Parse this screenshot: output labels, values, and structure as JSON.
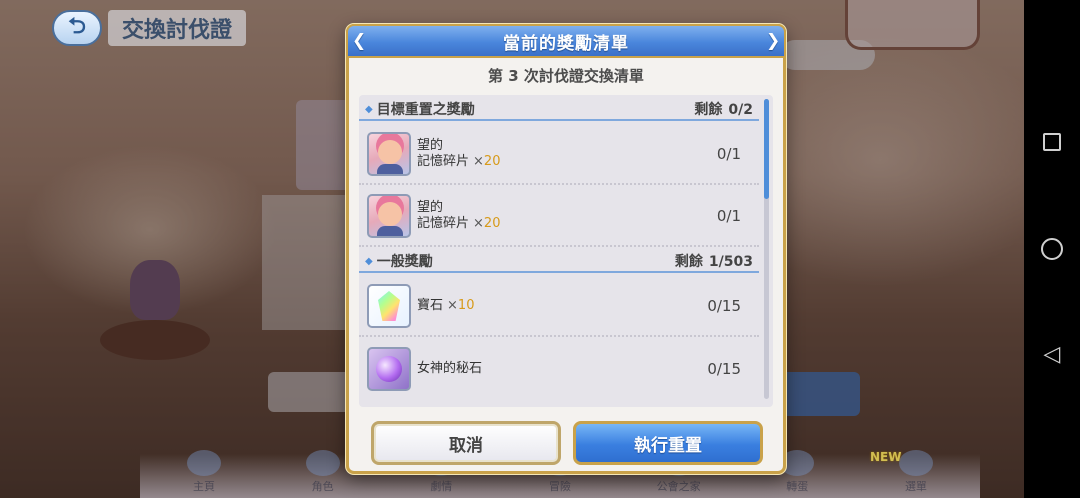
{
  "background": {
    "page_title": "交換討伐證",
    "back_icon": "back-arrow-icon",
    "nav_items": [
      "主頁",
      "角色",
      "劇情",
      "冒險",
      "公會之家",
      "轉蛋",
      "選單"
    ],
    "new_badge": "NEW"
  },
  "dialog": {
    "title": "當前的獎勵清單",
    "subtitle": "第 3 次討伐證交換清單",
    "sections": [
      {
        "title": "目標重置之獎勵",
        "remain_label": "剩餘",
        "remain_value": "0/2",
        "items": [
          {
            "name_line1": "望的",
            "name_line2": "記憶碎片",
            "qty_prefix": "×",
            "qty": "20",
            "count": "0/1",
            "icon": "character-portrait-icon"
          },
          {
            "name_line1": "望的",
            "name_line2": "記憶碎片",
            "qty_prefix": "×",
            "qty": "20",
            "count": "0/1",
            "icon": "character-portrait-icon"
          }
        ]
      },
      {
        "title": "一般獎勵",
        "remain_label": "剩餘",
        "remain_value": "1/503",
        "items": [
          {
            "name_line1": "寶石",
            "qty_prefix": "×",
            "qty": "10",
            "count": "0/15",
            "icon": "gem-icon"
          },
          {
            "name_line1": "女神的秘石",
            "count": "0/15",
            "icon": "goddess-stone-icon"
          }
        ]
      }
    ],
    "cancel_label": "取消",
    "execute_label": "執行重置"
  },
  "system_nav": {
    "recent_icon": "recent-apps-icon",
    "home_icon": "home-icon",
    "back_icon": "back-icon"
  },
  "colors": {
    "header_blue": "#4a86dc",
    "gold_border": "#c9a24a",
    "qty_orange": "#d79a1a",
    "section_diamond": "#4f8ed9"
  }
}
